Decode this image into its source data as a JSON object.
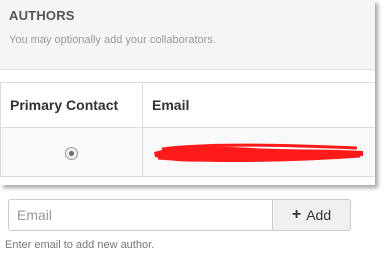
{
  "authors": {
    "title": "AUTHORS",
    "subtitle": "You may optionally add your collaborators.",
    "table": {
      "headers": [
        "Primary Contact",
        "Email"
      ],
      "rows": [
        {
          "primary_selected": true,
          "email_redacted": true
        }
      ]
    },
    "add_author": {
      "input_placeholder": "Email",
      "input_value": "",
      "button_label": "Add",
      "button_icon": "plus-icon",
      "help_text": "Enter email to add new author."
    }
  },
  "colors": {
    "header_background": "#f5f5f5",
    "redaction": "#ff1a1a",
    "border": "#dcdcdc"
  }
}
